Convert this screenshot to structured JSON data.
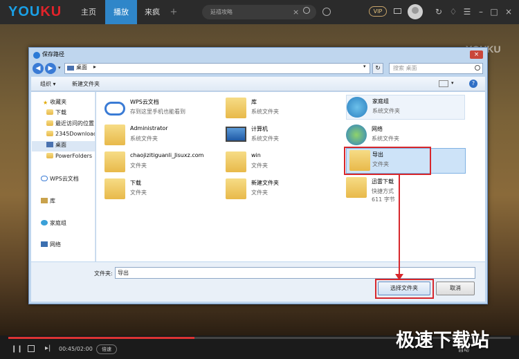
{
  "app": {
    "logo": "YOUKU",
    "nav": [
      "主页",
      "播放",
      "来疯"
    ],
    "nav_plus": "+",
    "search_text": "延禧攻略",
    "search_clear": "×",
    "vip": "VIP",
    "colors": {
      "accent": "#2f86c9",
      "logo_blue": "#1aa0e6",
      "logo_red": "#e2232a"
    }
  },
  "video": {
    "watermark": "YOUKU",
    "subtitle": "…",
    "site_watermark": "极速下载站"
  },
  "player": {
    "time": "00:45/02:00",
    "speed": "倍速",
    "auto": "自动",
    "progress": 0.37
  },
  "dialog": {
    "title": "保存路径",
    "close": "×",
    "address": "桌面",
    "address_arrow": "▸",
    "search_placeholder": "搜索 桌面",
    "toolbar": {
      "organize": "组织 ▾",
      "new_folder": "新建文件夹",
      "help": "?"
    },
    "nav_items": [
      {
        "label": "收藏夹",
        "icon": "star-icon"
      },
      {
        "label": "下载",
        "icon": "folder-icon"
      },
      {
        "label": "最近访问的位置",
        "icon": "folder-icon"
      },
      {
        "label": "2345Downloads",
        "icon": "folder-icon"
      },
      {
        "label": "桌面",
        "icon": "desktop-icon"
      },
      {
        "label": "PowerFolders",
        "icon": "folder-icon"
      },
      {
        "label": "WPS云文档",
        "icon": "cloud-icon"
      },
      {
        "label": "库",
        "icon": "library-icon"
      },
      {
        "label": "家庭组",
        "icon": "homegroup-icon"
      },
      {
        "label": "网络",
        "icon": "network-icon"
      }
    ],
    "files": [
      {
        "name": "WPS云文档",
        "type": "存到这里手机也能看到",
        "icon": "cloud-icon"
      },
      {
        "name": "库",
        "type": "系统文件夹",
        "icon": "library-icon"
      },
      {
        "name": "家庭组",
        "type": "系统文件夹",
        "icon": "homegroup-icon"
      },
      {
        "name": "Administrator",
        "type": "系统文件夹",
        "icon": "user-folder-icon"
      },
      {
        "name": "计算机",
        "type": "系统文件夹",
        "icon": "computer-icon"
      },
      {
        "name": "网络",
        "type": "系统文件夹",
        "icon": "network-icon"
      },
      {
        "name": "chaojizitiguanli_Jisuxz.com",
        "type": "文件夹",
        "icon": "folder-icon"
      },
      {
        "name": "win",
        "type": "文件夹",
        "icon": "folder-icon"
      },
      {
        "name": "导出",
        "type": "文件夹",
        "icon": "folder-icon"
      },
      {
        "name": "下载",
        "type": "文件夹",
        "icon": "folder-icon"
      },
      {
        "name": "新建文件夹",
        "type": "文件夹",
        "icon": "folder-icon"
      },
      {
        "name": "迅雷下载",
        "type": "快捷方式",
        "size": "611 字节",
        "icon": "shortcut-folder-icon"
      }
    ],
    "filename_label": "文件夹:",
    "filename_value": "导出",
    "select_button": "选择文件夹",
    "cancel_button": "取消"
  }
}
